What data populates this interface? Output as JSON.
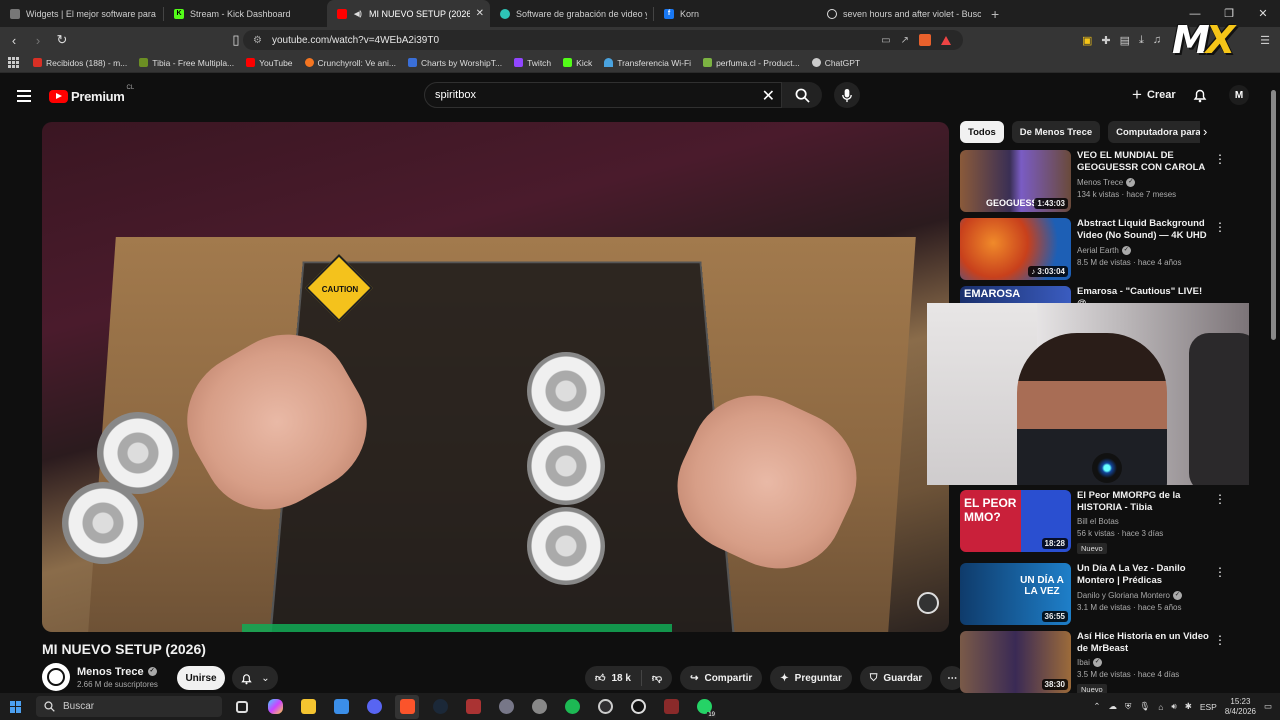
{
  "browser": {
    "tabs": [
      {
        "label": "Widgets | El mejor software para pot",
        "color": "#888888"
      },
      {
        "label": "Stream - Kick Dashboard",
        "color": "#53fc18"
      },
      {
        "label": "MI NUEVO SETUP (2026) - Yo",
        "color": "#ff0000"
      },
      {
        "label": "Software de grabación de video y str",
        "color": "#2ec4b6"
      },
      {
        "label": "Korn",
        "color": "#1877f2"
      },
      {
        "label": "seven hours and after violet - Buscar",
        "color": "#dddddd"
      }
    ],
    "url": "youtube.com/watch?v=4WEbA2i39T0",
    "bookmarks": [
      {
        "label": "Recibidos (188) - m...",
        "color": "#d93025"
      },
      {
        "label": "Tibia - Free Multipla...",
        "color": "#6b8e23"
      },
      {
        "label": "YouTube",
        "color": "#ff0000"
      },
      {
        "label": "Crunchyroll: Ve ani...",
        "color": "#f47521"
      },
      {
        "label": "Charts by WorshipT...",
        "color": "#3a6fd8"
      },
      {
        "label": "Twitch",
        "color": "#9146ff"
      },
      {
        "label": "Kick",
        "color": "#53fc18"
      },
      {
        "label": "Transferencia Wi-Fi",
        "color": "#4aa3df"
      },
      {
        "label": "perfuma.cl - Product...",
        "color": "#7cb342"
      },
      {
        "label": "ChatGPT",
        "color": "#cccccc"
      }
    ]
  },
  "youtube": {
    "logo_text": "Premium",
    "region": "CL",
    "search_value": "spiritbox",
    "create_label": "Crear",
    "avatar_letter": "M"
  },
  "video": {
    "caution_label": "CAUTION",
    "title": "MI NUEVO SETUP (2026)",
    "channel": "Menos Trece",
    "subscribers": "2.66 M de suscriptores",
    "join_label": "Unirse",
    "likes": "18 k",
    "share_label": "Compartir",
    "ask_label": "Preguntar",
    "save_label": "Guardar"
  },
  "chips": [
    "Todos",
    "De Menos Trece",
    "Computadora para ju"
  ],
  "recommendations": [
    {
      "title": "VEO EL MUNDIAL DE GEOGUESSR CON CAROLA Y ...",
      "channel": "Menos Trece",
      "views": "134 k vistas · hace 7 meses",
      "duration": "1:43:03",
      "thumb_text": "GEOGUESS",
      "colors": [
        "#2a2f4a",
        "#7a5cc4"
      ],
      "verified": true,
      "badge": ""
    },
    {
      "title": "Abstract Liquid Background Video (No Sound) — 4K UHD ...",
      "channel": "Aerial Earth",
      "views": "8.5 M de vistas · hace 4 años",
      "duration": "3:03:04",
      "thumb_text": "",
      "colors": [
        "#c8401c",
        "#1d5fb5"
      ],
      "verified": true,
      "badge": ""
    },
    {
      "title": "Emarosa - \"Cautious\" LIVE! @",
      "channel": "",
      "views": "",
      "duration": "",
      "thumb_text": "EMAROSA",
      "colors": [
        "#1a2f6b",
        "#3a5cc0"
      ],
      "verified": false,
      "badge": ""
    },
    {
      "title": "El Peor MMORPG de la HISTORIA - Tibia",
      "channel": "Bill el Botas",
      "views": "56 k vistas · hace 3 días",
      "duration": "18:28",
      "thumb_text": "EL PEOR MMO?",
      "colors": [
        "#c9203a",
        "#2a4fd0"
      ],
      "verified": false,
      "badge": "Nuevo"
    },
    {
      "title": "Un Día A La Vez - Danilo Montero | Prédicas Cristianas",
      "channel": "Danilo y Gloriana Montero",
      "views": "3.1 M de vistas · hace 5 años",
      "duration": "36:55",
      "thumb_text": "UN DÍA A LA VEZ",
      "colors": [
        "#0f3b6b",
        "#1e7fc9"
      ],
      "verified": true,
      "badge": ""
    },
    {
      "title": "Así Hice Historia en un Video de MrBeast",
      "channel": "Ibai",
      "views": "3.5 M de vistas · hace 4 días",
      "duration": "38:30",
      "thumb_text": "",
      "colors": [
        "#3a2a55",
        "#9c6b3a"
      ],
      "verified": true,
      "badge": "Nuevo"
    }
  ],
  "taskbar": {
    "search_placeholder": "Buscar",
    "lang": "ESP",
    "time": "15:23",
    "date": "8/4/2026",
    "whatsapp_badge": "19"
  },
  "watermark": {
    "m": "M",
    "x": "X"
  }
}
